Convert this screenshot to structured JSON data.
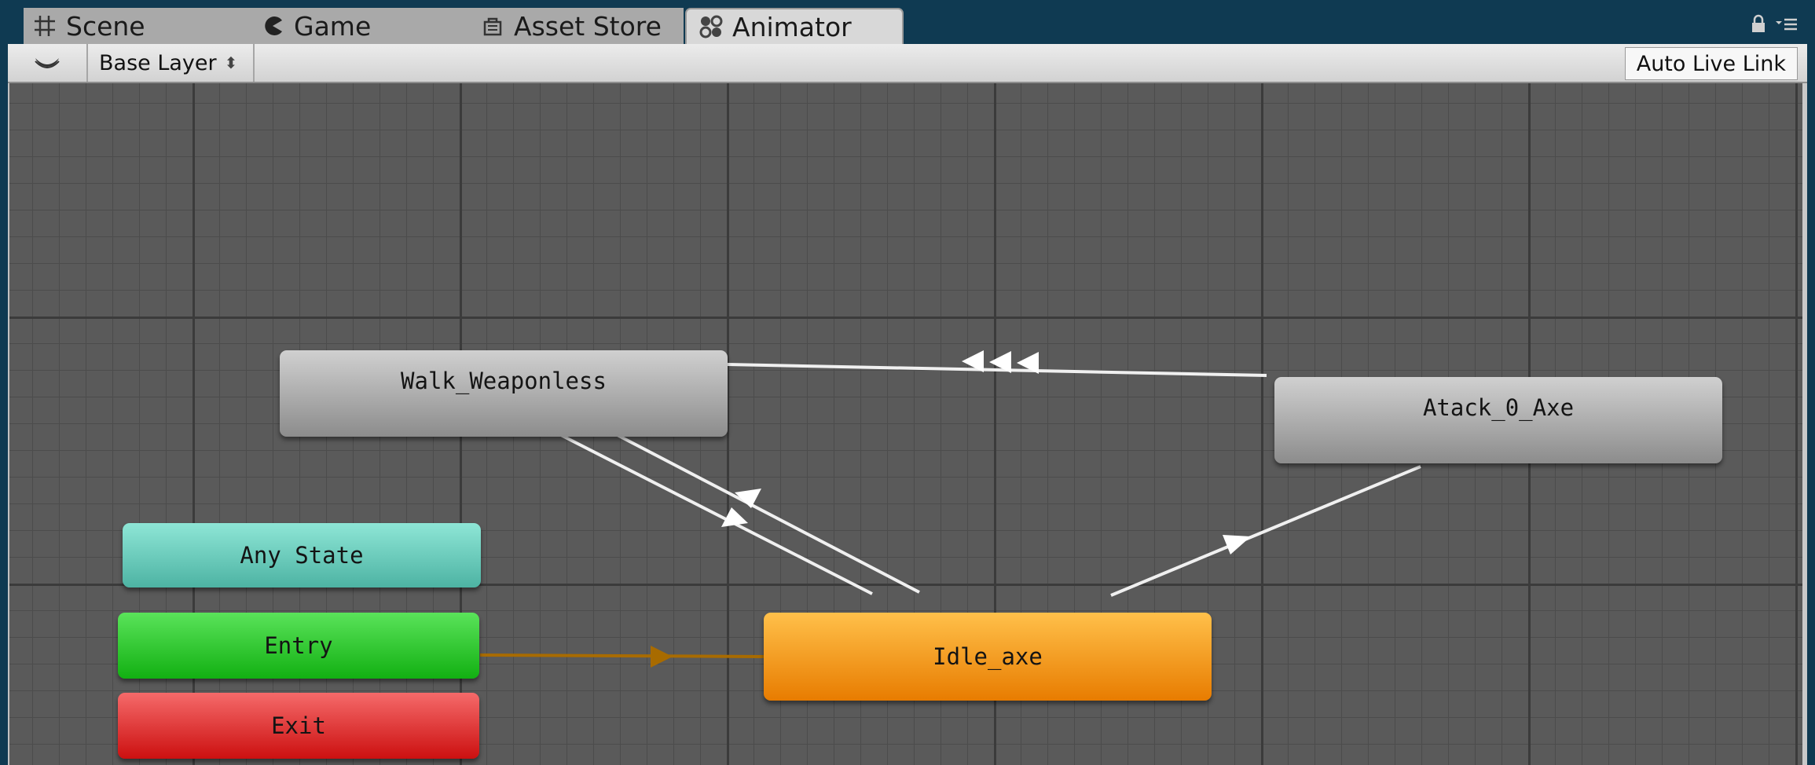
{
  "tabs": [
    {
      "label": "Scene",
      "icon": "grid-icon",
      "active": false
    },
    {
      "label": "Game",
      "icon": "pacman-icon",
      "active": false
    },
    {
      "label": "Asset Store",
      "icon": "shopping-bag-icon",
      "active": false
    },
    {
      "label": "Animator",
      "icon": "animator-icon",
      "active": true
    }
  ],
  "toolbar": {
    "eye_icon": "eye-icon",
    "layer_label": "Base Layer",
    "layer_arrows": "⬍",
    "live_link_label": "Auto Live Link"
  },
  "window_controls": {
    "lock_icon": "lock-icon",
    "menu_icon": "menu-icon"
  },
  "states": {
    "walk": {
      "label": "Walk_Weaponless",
      "color": "#b0b0b0"
    },
    "attack": {
      "label": "Atack_0_Axe",
      "color": "#b0b0b0"
    },
    "any": {
      "label": "Any State",
      "color": "#6fcfbf"
    },
    "entry": {
      "label": "Entry",
      "color": "#2ec92e"
    },
    "exit": {
      "label": "Exit",
      "color": "#e02a2a"
    },
    "idle": {
      "label": "Idle_axe",
      "color": "#f59b1f"
    }
  },
  "transitions": [
    {
      "from": "Atack_0_Axe",
      "to": "Walk_Weaponless",
      "arrows": 3
    },
    {
      "from": "Walk_Weaponless",
      "to": "Idle_axe",
      "arrows": 1
    },
    {
      "from": "Idle_axe",
      "to": "Walk_Weaponless",
      "arrows": 1
    },
    {
      "from": "Idle_axe",
      "to": "Atack_0_Axe",
      "arrows": 1
    },
    {
      "from": "Entry",
      "to": "Idle_axe",
      "arrows": 1,
      "default": true
    }
  ],
  "colors": {
    "transition": "#ffffff",
    "default_transition": "#a86b00",
    "canvas_bg": "#5a5a5a"
  }
}
